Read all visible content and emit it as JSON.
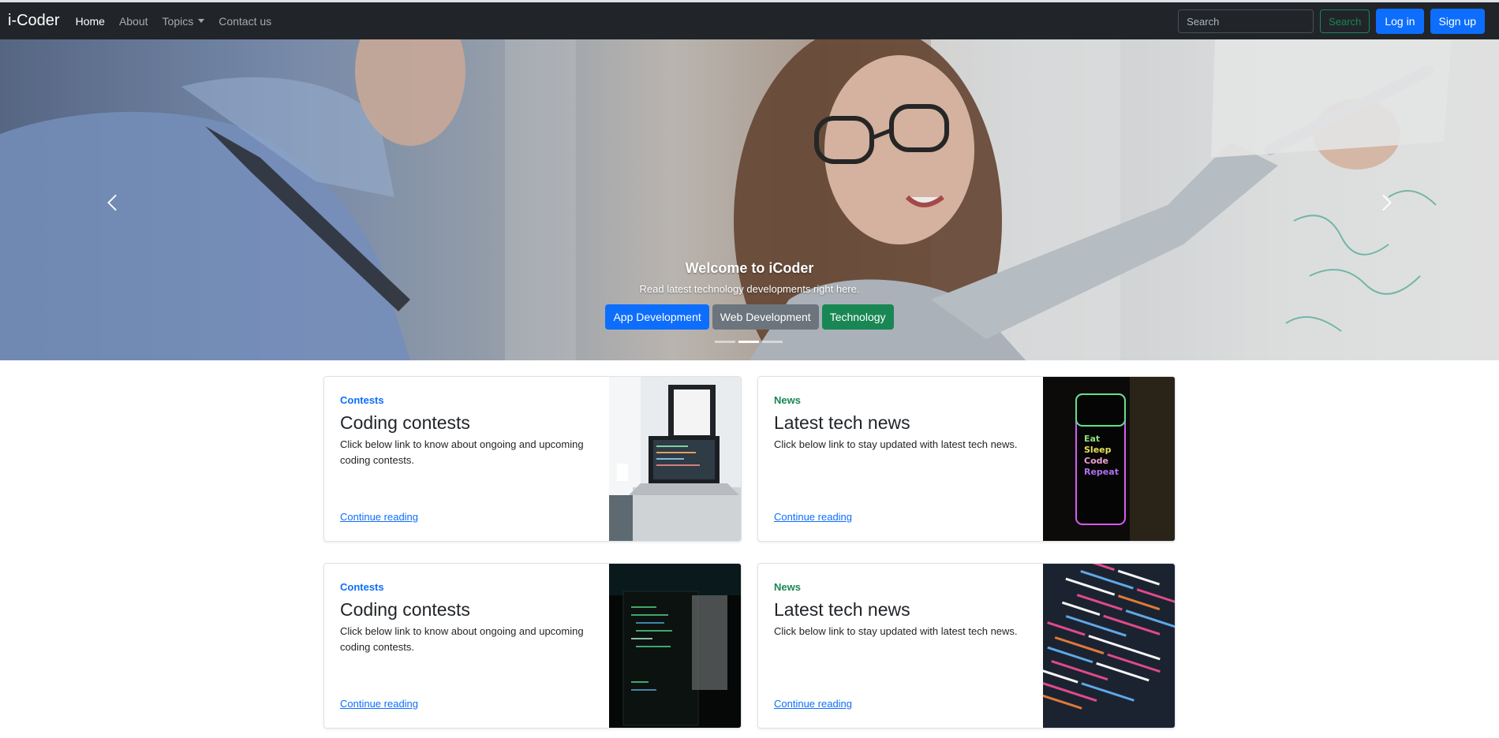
{
  "navbar": {
    "brand": "i-Coder",
    "links": [
      {
        "label": "Home",
        "active": true
      },
      {
        "label": "About",
        "active": false
      },
      {
        "label": "Topics",
        "active": false,
        "dropdown": true
      },
      {
        "label": "Contact us",
        "active": false
      }
    ],
    "search_placeholder": "Search",
    "search_button": "Search",
    "login_button": "Log in",
    "signup_button": "Sign up"
  },
  "carousel": {
    "title": "Welcome to iCoder",
    "subtitle": "Read latest technology developments right here.",
    "buttons": [
      {
        "label": "App Development",
        "color": "#0d6efd"
      },
      {
        "label": "Web Development",
        "color": "#6c757d"
      },
      {
        "label": "Technology",
        "color": "#198754"
      }
    ],
    "indicator_count": 3,
    "active_indicator": 1
  },
  "cards": [
    {
      "category": "Contests",
      "category_color": "#0d6efd",
      "title": "Coding contests",
      "text": "Click below link to know about ongoing and upcoming coding contests.",
      "link": "Continue reading",
      "image": "laptop-desk"
    },
    {
      "category": "News",
      "category_color": "#198754",
      "title": "Latest tech news",
      "text": "Click below link to stay updated with latest tech news.",
      "link": "Continue reading",
      "image": "phone-eat-sleep-code"
    },
    {
      "category": "Contests",
      "category_color": "#0d6efd",
      "title": "Coding contests",
      "text": "Click below link to know about ongoing and upcoming coding contests.",
      "link": "Continue reading",
      "image": "dark-screen-code"
    },
    {
      "category": "News",
      "category_color": "#198754",
      "title": "Latest tech news",
      "text": "Click below link to stay updated with latest tech news.",
      "link": "Continue reading",
      "image": "colorful-code"
    }
  ],
  "phone_screen_text": "Eat Sleep Code Repeat"
}
